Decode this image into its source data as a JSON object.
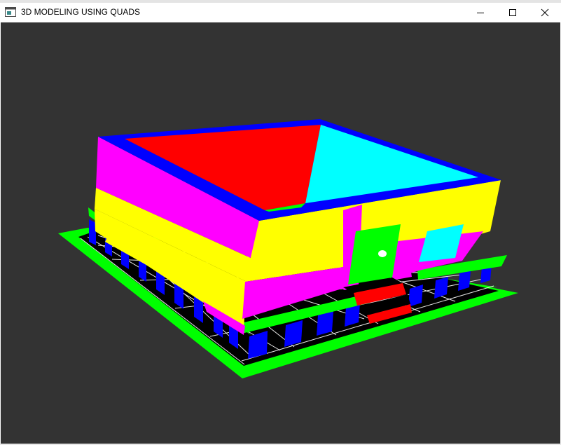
{
  "window": {
    "title": "3D MODELING USING QUADS",
    "controls": [
      {
        "name": "minimize-button",
        "icon": "minimize-icon"
      },
      {
        "name": "maximize-button",
        "icon": "maximize-icon"
      },
      {
        "name": "close-button",
        "icon": "close-icon"
      }
    ]
  },
  "colors": {
    "viewport_background": "#333333",
    "green": "#00ff00",
    "blue": "#0000ff",
    "red": "#ff0000",
    "cyan": "#00ffff",
    "magenta": "#ff00ff",
    "yellow": "#ffff00",
    "white": "#ffffff",
    "black": "#000000"
  }
}
